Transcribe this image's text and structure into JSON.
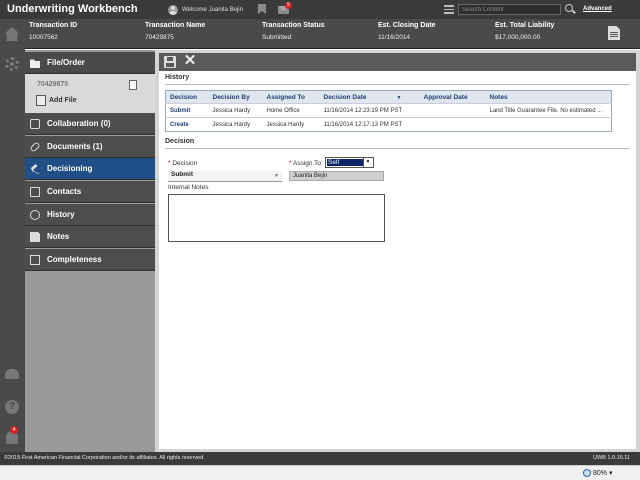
{
  "app": {
    "title": "Underwriting Workbench"
  },
  "topbar": {
    "welcome": "Welcome Juanita Bejin",
    "mail_count": "5",
    "search_placeholder": "Search Content",
    "advanced_label": "Advanced"
  },
  "transaction": {
    "columns": [
      {
        "label": "Transaction ID",
        "value": "10007562"
      },
      {
        "label": "Transaction Name",
        "value": "70429875"
      },
      {
        "label": "Transaction Status",
        "value": "Submitted"
      },
      {
        "label": "Est. Closing Date",
        "value": "11/16/2014"
      },
      {
        "label": "Est. Total Liability",
        "value": "$17,000,000.00"
      }
    ]
  },
  "rail": {
    "notification_count": "4"
  },
  "sidenav": {
    "file_order": "File/Order",
    "file_number": "70429875",
    "add_file": "Add File",
    "items": [
      {
        "label": "Collaboration (0)",
        "icon": "collaboration-icon"
      },
      {
        "label": "Documents (1)",
        "icon": "paperclip-icon"
      },
      {
        "label": "Decisioning",
        "icon": "gavel-icon",
        "active": true
      },
      {
        "label": "Contacts",
        "icon": "contacts-icon"
      },
      {
        "label": "History",
        "icon": "history-icon"
      },
      {
        "label": "Notes",
        "icon": "notes-icon"
      },
      {
        "label": "Completeness",
        "icon": "checklist-icon"
      }
    ]
  },
  "history": {
    "title": "History",
    "headers": [
      "Decision",
      "Decision By",
      "Assigned To",
      "Decision Date",
      "Approval Date",
      "Notes"
    ],
    "rows": [
      [
        "Submit",
        "Jessica Hardy",
        "Home Office",
        "11/16/2014 12:23:19 PM PST",
        "",
        "Land Title Guarantee File. No estimated ..."
      ],
      [
        "Create",
        "Jessica Hardy",
        "Jessica Hardy",
        "11/16/2014 12:17:13 PM PST",
        "",
        ""
      ]
    ]
  },
  "decision": {
    "title": "Decision",
    "decision_label": "Decision",
    "decision_value": "Submit",
    "assign_label": "Assign To:",
    "assign_value": "Self",
    "assignee": "Juanita Bejin",
    "notes_label": "Internal Notes"
  },
  "footer": {
    "copyright": "©2015 First American Financial Corporation and/or its affiliates. All rights reserved.",
    "version": "UWB 1.0.15.11",
    "zoom": "80%"
  }
}
